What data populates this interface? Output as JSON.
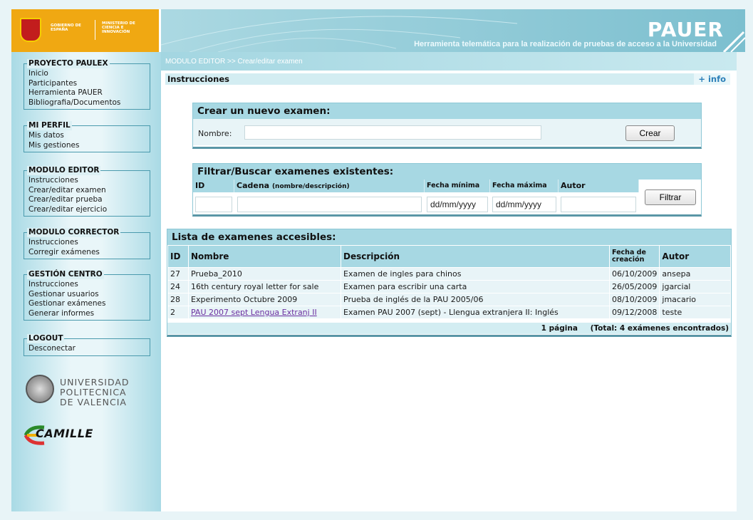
{
  "header": {
    "gov_text": "GOBIERNO DE ESPAÑA",
    "ministry_text": "MINISTERIO DE CIENCIA E INNOVACIÓN",
    "title": "PAUER",
    "subtitle": "Herramienta telemática para la realización de pruebas de acceso a la Universidad"
  },
  "sidebar": {
    "groups": [
      {
        "legend": "PROYECTO PAULEX",
        "items": [
          "Inicio",
          "Participantes",
          "Herramienta PAUER",
          "Bibliografia/Documentos"
        ]
      },
      {
        "legend": "MI PERFIL",
        "items": [
          "Mis datos",
          "Mis gestiones"
        ]
      },
      {
        "legend": "MODULO EDITOR",
        "items": [
          "Instrucciones",
          "Crear/editar examen",
          "Crear/editar prueba",
          "Crear/editar ejercicio"
        ]
      },
      {
        "legend": "MODULO CORRECTOR",
        "items": [
          "Instrucciones",
          "Corregir exámenes"
        ]
      },
      {
        "legend": "GESTIÓN CENTRO",
        "items": [
          "Instrucciones",
          "Gestionar usuarios",
          "Gestionar exámenes",
          "Generar informes"
        ]
      },
      {
        "legend": "LOGOUT",
        "items": [
          "Desconectar"
        ]
      }
    ],
    "upv_lines": [
      "UNIVERSIDAD",
      "POLITECNICA",
      "DE VALENCIA"
    ],
    "camille_text": "CAMILLE"
  },
  "main": {
    "breadcrumb": "MODULO EDITOR   >> Crear/editar examen",
    "instr_title": "Instrucciones",
    "plus_info": "+ info",
    "create": {
      "title": "Crear un nuevo examen:",
      "nombre_label": "Nombre:",
      "nombre_value": "",
      "button": "Crear"
    },
    "filter": {
      "title": "Filtrar/Buscar examenes existentes:",
      "headers": {
        "id": "ID",
        "cadena": "Cadena",
        "cadena_hint": "(nombre/descripción)",
        "fecha_min": "Fecha mínima",
        "fecha_max": "Fecha máxima",
        "autor": "Autor"
      },
      "values": {
        "id": "",
        "cadena": "",
        "fecha_min": "dd/mm/yyyy",
        "fecha_max": "dd/mm/yyyy",
        "autor": ""
      },
      "button": "Filtrar"
    },
    "list": {
      "title": "Lista de examenes accesibles:",
      "headers": [
        "ID",
        "Nombre",
        "Descripción",
        "Fecha de creación",
        "Autor"
      ],
      "rows": [
        {
          "id": "27",
          "nombre": "Prueba_2010",
          "descripcion": "Examen de ingles para chinos",
          "fecha": "06/10/2009",
          "autor": "ansepa"
        },
        {
          "id": "24",
          "nombre": "16th century royal letter for sale",
          "descripcion": "Examen para escribir una carta",
          "fecha": "26/05/2009",
          "autor": "jgarcial"
        },
        {
          "id": "28",
          "nombre": "Experimento Octubre 2009",
          "descripcion": "Prueba de inglés de la PAU 2005/06",
          "fecha": "08/10/2009",
          "autor": "jmacario"
        },
        {
          "id": "2",
          "nombre": "PAU 2007 sept Lengua Extranj II",
          "descripcion": "Examen PAU 2007 (sept) - Llengua extranjera II: Inglés",
          "fecha": "09/12/2008",
          "autor": "teste"
        }
      ],
      "footer_pages": "1 página",
      "footer_total": "(Total: 4 exámenes encontrados)"
    }
  },
  "colors": {
    "header_gold": "#f0a812",
    "accent_light": "#a7d8e3",
    "row_bg": "#e8f4f7",
    "link_visited": "#6b2fa0",
    "info_link": "#2c7fb8"
  }
}
